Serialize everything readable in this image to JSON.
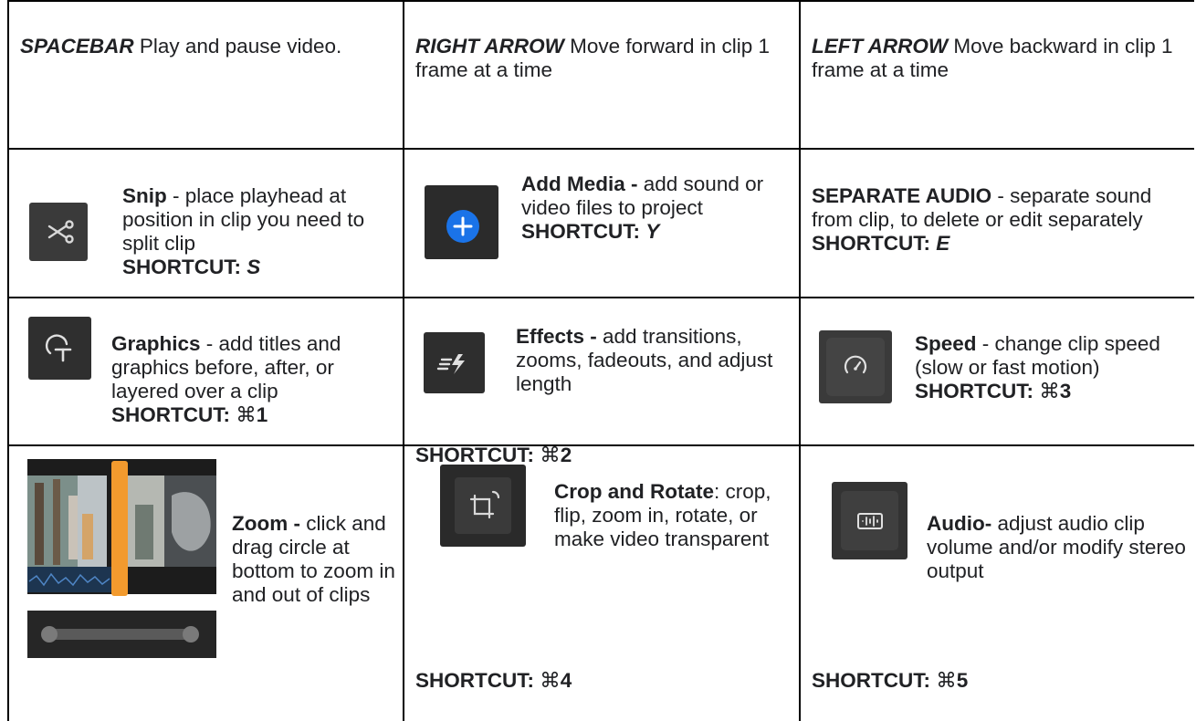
{
  "row1": {
    "c1": {
      "key": "SPACEBAR",
      "desc": " Play and pause video."
    },
    "c2": {
      "key": "RIGHT ARROW",
      "desc": " Move forward in clip 1 frame at a time"
    },
    "c3": {
      "key": "LEFT ARROW",
      "desc": " Move backward in clip 1 frame at a time"
    }
  },
  "row2": {
    "c1": {
      "title": "Snip",
      "desc": " - place playhead at position in clip you need to split clip",
      "shortcut_label": "SHORTCUT: ",
      "shortcut_key": "S",
      "icon": "scissors-icon"
    },
    "c2": {
      "title": "Add Media -",
      "desc": " add sound or video files to project",
      "shortcut_label": "SHORTCUT: ",
      "shortcut_key": "Y",
      "icon": "plus-circle-icon",
      "icon_color": "#1a73e8"
    },
    "c3": {
      "title": "SEPARATE AUDIO",
      "desc": " - separate sound from clip, to delete or edit separately",
      "shortcut_label": "SHORTCUT: ",
      "shortcut_key": "E"
    }
  },
  "row3": {
    "c1": {
      "title": "Graphics",
      "desc": " - add titles and graphics before, after, or layered over a clip",
      "shortcut_label": "SHORTCUT: ",
      "shortcut_sym": "⌘",
      "shortcut_key": "1",
      "icon": "graphics-icon"
    },
    "c2": {
      "title": "Effects -",
      "desc": " add transitions, zooms, fadeouts, and adjust length",
      "shortcut_label": "SHORTCUT: ",
      "shortcut_sym": "⌘",
      "shortcut_key": "2",
      "icon": "effects-icon"
    },
    "c3": {
      "title": "Speed",
      "desc": " - change clip speed (slow or fast motion)",
      "shortcut_label": "SHORTCUT: ",
      "shortcut_sym": "⌘",
      "shortcut_key": "3",
      "icon": "speedometer-icon"
    }
  },
  "row4": {
    "c1": {
      "title": "Zoom -",
      "desc": " click and drag circle at bottom to zoom in and out of clips",
      "icon": "timeline-zoom-thumbnail"
    },
    "c2": {
      "title": "Crop and Rotate",
      "desc": ": crop, flip, zoom in, rotate, or make video transparent",
      "shortcut_label": "SHORTCUT: ",
      "shortcut_sym": "⌘",
      "shortcut_key": "4",
      "icon": "crop-rotate-icon"
    },
    "c3": {
      "title": "Audio-",
      "desc": " adjust audio clip volume and/or modify stereo output",
      "shortcut_label": "SHORTCUT: ",
      "shortcut_sym": "⌘",
      "shortcut_key": "5",
      "icon": "audio-waveform-icon"
    }
  }
}
